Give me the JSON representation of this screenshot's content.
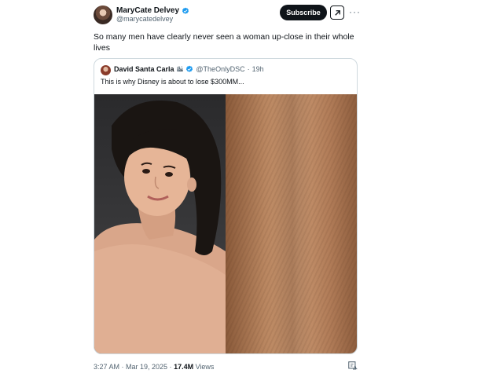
{
  "author": {
    "name": "MaryCate Delvey",
    "handle": "@marycatedelvey"
  },
  "actions": {
    "subscribe_label": "Subscribe",
    "grok_icon": "grok-icon",
    "more_icon": "more-icon"
  },
  "post": {
    "text": "So many men have clearly never seen a woman up-close in their whole lives"
  },
  "quoted": {
    "name": "David Santa Carla",
    "flag_glyph": "🏙",
    "handle": "@TheOnlyDSC",
    "separator": "·",
    "time": "19h",
    "text": "This is why Disney is about to lose $300MM..."
  },
  "meta": {
    "time": "3:27 AM · Mar 19, 2025 · ",
    "views_count": "17.4M",
    "views_label": " Views"
  },
  "colors": {
    "verified": "#1d9bf0",
    "text_primary": "#0f1419",
    "text_secondary": "#536471",
    "border": "#cfd9de"
  }
}
